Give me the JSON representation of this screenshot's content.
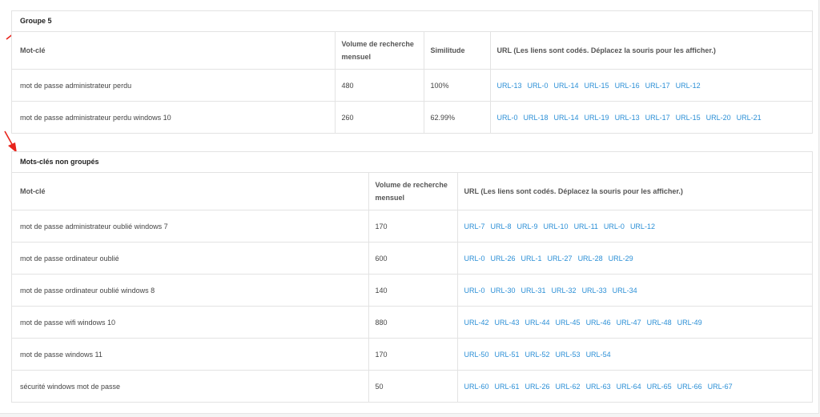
{
  "groups": [
    {
      "title": "Groupe 5",
      "headers": {
        "keyword": "Mot-clé",
        "volume": "Volume de recherche mensuel",
        "similarity": "Similitude",
        "urls": "URL (Les liens sont codés. Déplacez la souris pour les afficher.)"
      },
      "rows": [
        {
          "keyword": "mot de passe administrateur perdu",
          "volume": "480",
          "similarity": "100%",
          "urls": [
            "URL-13",
            "URL-0",
            "URL-14",
            "URL-15",
            "URL-16",
            "URL-17",
            "URL-12"
          ]
        },
        {
          "keyword": "mot de passe administrateur perdu windows 10",
          "volume": "260",
          "similarity": "62.99%",
          "urls": [
            "URL-0",
            "URL-18",
            "URL-14",
            "URL-19",
            "URL-13",
            "URL-17",
            "URL-15",
            "URL-20",
            "URL-21"
          ]
        }
      ]
    },
    {
      "title": "Mots-clés non groupés",
      "headers": {
        "keyword": "Mot-clé",
        "volume": "Volume de recherche mensuel",
        "urls": "URL (Les liens sont codés. Déplacez la souris pour les afficher.)"
      },
      "rows": [
        {
          "keyword": "mot de passe administrateur oublié windows 7",
          "volume": "170",
          "urls": [
            "URL-7",
            "URL-8",
            "URL-9",
            "URL-10",
            "URL-11",
            "URL-0",
            "URL-12"
          ]
        },
        {
          "keyword": "mot de passe ordinateur oublié",
          "volume": "600",
          "urls": [
            "URL-0",
            "URL-26",
            "URL-1",
            "URL-27",
            "URL-28",
            "URL-29"
          ]
        },
        {
          "keyword": "mot de passe ordinateur oublié windows 8",
          "volume": "140",
          "urls": [
            "URL-0",
            "URL-30",
            "URL-31",
            "URL-32",
            "URL-33",
            "URL-34"
          ]
        },
        {
          "keyword": "mot de passe wifi windows 10",
          "volume": "880",
          "urls": [
            "URL-42",
            "URL-43",
            "URL-44",
            "URL-45",
            "URL-46",
            "URL-47",
            "URL-48",
            "URL-49"
          ]
        },
        {
          "keyword": "mot de passe windows 11",
          "volume": "170",
          "urls": [
            "URL-50",
            "URL-51",
            "URL-52",
            "URL-53",
            "URL-54"
          ]
        },
        {
          "keyword": "sécurité windows mot de passe",
          "volume": "50",
          "urls": [
            "URL-60",
            "URL-61",
            "URL-26",
            "URL-62",
            "URL-63",
            "URL-64",
            "URL-65",
            "URL-66",
            "URL-67"
          ]
        }
      ]
    }
  ],
  "colors": {
    "link": "#2b8fd6",
    "arrow": "#e8241c",
    "border": "#e3e3e3"
  }
}
